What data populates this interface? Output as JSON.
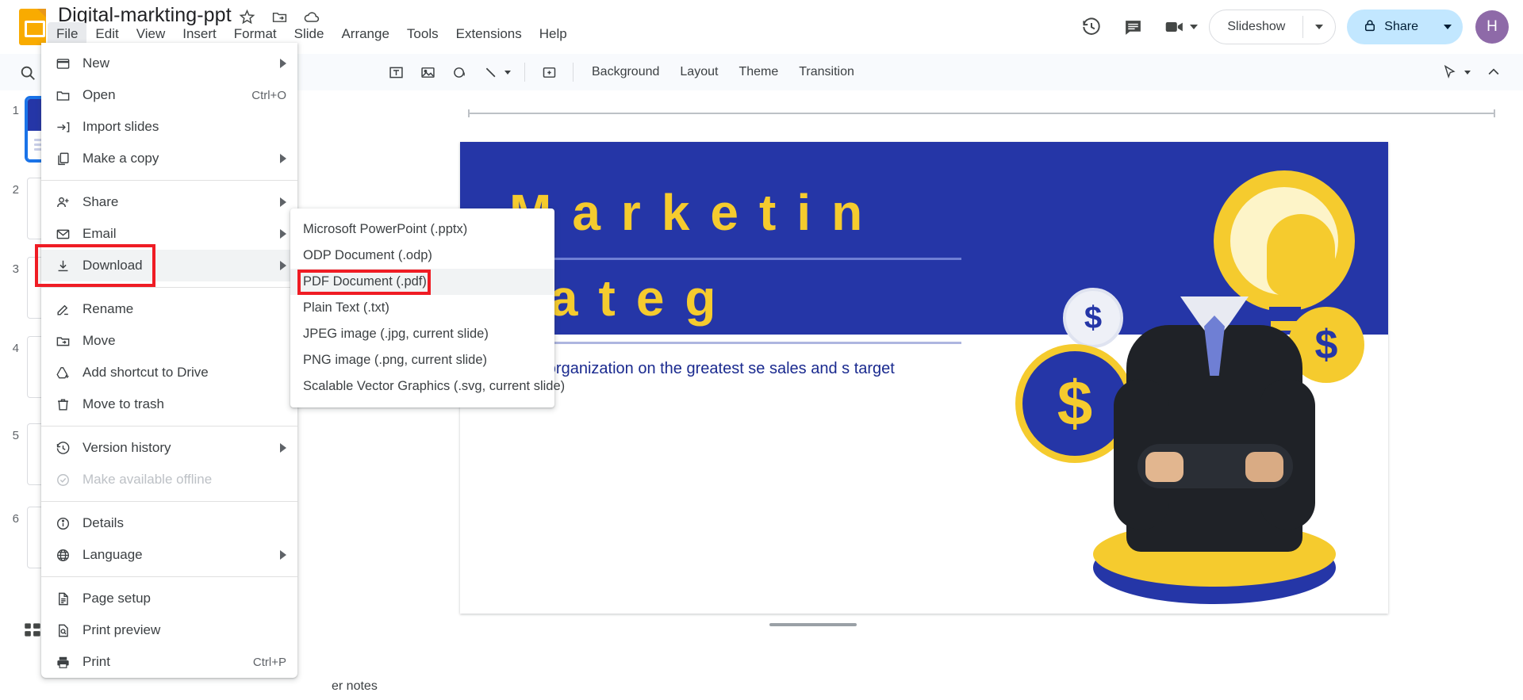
{
  "app": {
    "logo_icon": "google-slides-logo",
    "doc_title": "Digital-markting-ppt",
    "title_icons": [
      "star-icon",
      "move-to-folder-icon",
      "cloud-saved-icon"
    ]
  },
  "menubar": {
    "items": [
      {
        "label": "File",
        "active": true
      },
      {
        "label": "Edit",
        "active": false
      },
      {
        "label": "View",
        "active": false
      },
      {
        "label": "Insert",
        "active": false
      },
      {
        "label": "Format",
        "active": false
      },
      {
        "label": "Slide",
        "active": false
      },
      {
        "label": "Arrange",
        "active": false
      },
      {
        "label": "Tools",
        "active": false
      },
      {
        "label": "Extensions",
        "active": false
      },
      {
        "label": "Help",
        "active": false
      }
    ]
  },
  "top_right": {
    "history_icon": "version-history-icon",
    "comment_icon": "comment-icon",
    "meet_icon": "video-camera-icon",
    "meet_caret_icon": "chevron-down-icon",
    "slideshow_label": "Slideshow",
    "slideshow_caret_icon": "chevron-down-icon",
    "share_label": "Share",
    "share_lock_icon": "lock-icon",
    "share_caret_icon": "chevron-down-icon",
    "avatar_initial": "H",
    "avatar_color": "#8e6aa8",
    "share_bg": "#c2e7ff"
  },
  "toolbar": {
    "search_icon": "search-icon",
    "buttons": [
      {
        "icon": "text-box-icon",
        "name": "text-box-button"
      },
      {
        "icon": "image-icon",
        "name": "insert-image-button"
      },
      {
        "icon": "shape-icon",
        "name": "shape-button"
      },
      {
        "icon": "line-icon",
        "name": "line-button"
      }
    ],
    "line_caret_icon": "chevron-down-icon",
    "add_comment_icon": "add-comment-icon",
    "text_buttons": [
      "Background",
      "Layout",
      "Theme",
      "Transition"
    ],
    "right_icons": [
      "cursor-pointer-icon",
      "chevron-down-icon",
      "collapse-toolbar-icon"
    ]
  },
  "filmstrip": {
    "slides": [
      {
        "number": "1",
        "selected": true
      },
      {
        "number": "2",
        "selected": false
      },
      {
        "number": "3",
        "selected": false
      },
      {
        "number": "4",
        "selected": false
      },
      {
        "number": "5",
        "selected": false
      },
      {
        "number": "6",
        "selected": false
      }
    ],
    "grid_view_icon": "grid-view-icon"
  },
  "canvas": {
    "slide": {
      "title_line1": "Marketin",
      "title_line2": "rateg",
      "body_text": "w an organization on the greatest se sales and s target",
      "coin_symbol": "$",
      "title_color": "#f5cb2e",
      "banner_color": "#2536a7"
    },
    "notes_placeholder": "er notes"
  },
  "file_menu": {
    "groups": [
      {
        "items": [
          {
            "label": "New",
            "icon": "new-presentation-icon",
            "arrow": true,
            "shortcut": "",
            "disabled": false,
            "highlighted": false
          },
          {
            "label": "Open",
            "icon": "folder-open-icon",
            "arrow": false,
            "shortcut": "Ctrl+O",
            "disabled": false,
            "highlighted": false
          },
          {
            "label": "Import slides",
            "icon": "import-slides-icon",
            "arrow": false,
            "shortcut": "",
            "disabled": false,
            "highlighted": false
          },
          {
            "label": "Make a copy",
            "icon": "copy-icon",
            "arrow": true,
            "shortcut": "",
            "disabled": false,
            "highlighted": false
          }
        ]
      },
      {
        "items": [
          {
            "label": "Share",
            "icon": "person-add-icon",
            "arrow": true,
            "shortcut": "",
            "disabled": false,
            "highlighted": false
          },
          {
            "label": "Email",
            "icon": "envelope-icon",
            "arrow": true,
            "shortcut": "",
            "disabled": false,
            "highlighted": false
          },
          {
            "label": "Download",
            "icon": "download-icon",
            "arrow": true,
            "shortcut": "",
            "disabled": false,
            "highlighted": true
          }
        ]
      },
      {
        "items": [
          {
            "label": "Rename",
            "icon": "pencil-icon",
            "arrow": false,
            "shortcut": "",
            "disabled": false,
            "highlighted": false
          },
          {
            "label": "Move",
            "icon": "move-folder-icon",
            "arrow": false,
            "shortcut": "",
            "disabled": false,
            "highlighted": false
          },
          {
            "label": "Add shortcut to Drive",
            "icon": "drive-shortcut-icon",
            "arrow": false,
            "shortcut": "",
            "disabled": false,
            "highlighted": false
          },
          {
            "label": "Move to trash",
            "icon": "trash-icon",
            "arrow": false,
            "shortcut": "",
            "disabled": false,
            "highlighted": false
          }
        ]
      },
      {
        "items": [
          {
            "label": "Version history",
            "icon": "history-icon",
            "arrow": true,
            "shortcut": "",
            "disabled": false,
            "highlighted": false
          },
          {
            "label": "Make available offline",
            "icon": "offline-check-icon",
            "arrow": false,
            "shortcut": "",
            "disabled": true,
            "highlighted": false
          }
        ]
      },
      {
        "items": [
          {
            "label": "Details",
            "icon": "info-icon",
            "arrow": false,
            "shortcut": "",
            "disabled": false,
            "highlighted": false
          },
          {
            "label": "Language",
            "icon": "globe-icon",
            "arrow": true,
            "shortcut": "",
            "disabled": false,
            "highlighted": false
          }
        ]
      },
      {
        "items": [
          {
            "label": "Page setup",
            "icon": "page-setup-icon",
            "arrow": false,
            "shortcut": "",
            "disabled": false,
            "highlighted": false
          },
          {
            "label": "Print preview",
            "icon": "print-preview-icon",
            "arrow": false,
            "shortcut": "",
            "disabled": false,
            "highlighted": false
          },
          {
            "label": "Print",
            "icon": "printer-icon",
            "arrow": false,
            "shortcut": "Ctrl+P",
            "disabled": false,
            "highlighted": false
          }
        ]
      }
    ],
    "highlight_color": "#ef1c24"
  },
  "download_submenu": {
    "items": [
      {
        "label": "Microsoft PowerPoint (.pptx)",
        "highlighted": false
      },
      {
        "label": "ODP Document (.odp)",
        "highlighted": false
      },
      {
        "label": "PDF Document (.pdf)",
        "highlighted": true
      },
      {
        "label": "Plain Text (.txt)",
        "highlighted": false
      },
      {
        "label": "JPEG image (.jpg, current slide)",
        "highlighted": false
      },
      {
        "label": "PNG image (.png, current slide)",
        "highlighted": false
      },
      {
        "label": "Scalable Vector Graphics (.svg, current slide)",
        "highlighted": false
      }
    ]
  }
}
